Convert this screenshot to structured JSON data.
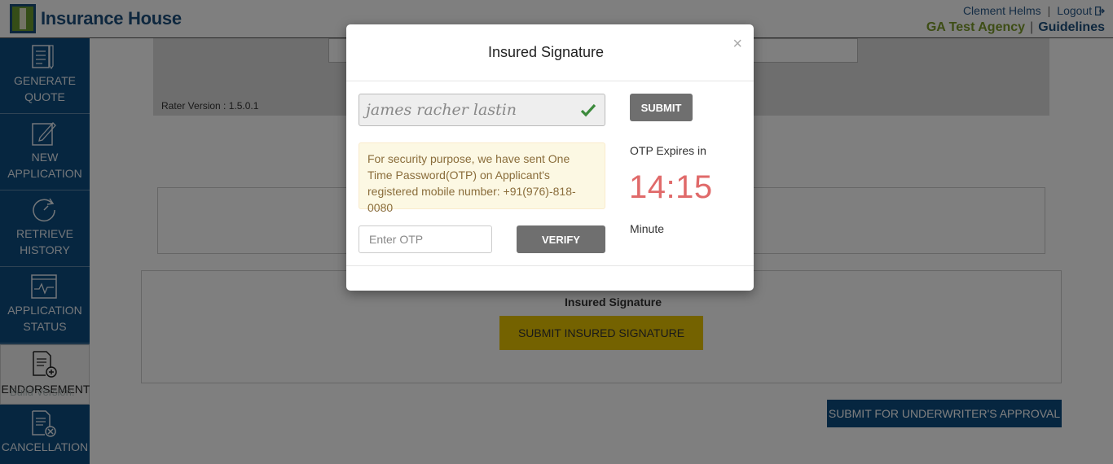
{
  "header": {
    "logo_text": "Insurance House",
    "user_name": "Clement Helms",
    "logout_label": "Logout",
    "agency_name": "GA Test Agency",
    "guidelines_label": "Guidelines"
  },
  "sidebar": {
    "items": [
      {
        "label": "GENERATE QUOTE",
        "icon": "generate-quote-icon"
      },
      {
        "label": "NEW APPLICATION",
        "icon": "edit-icon"
      },
      {
        "label": "RETRIEVE HISTORY",
        "icon": "history-icon"
      },
      {
        "label": "APPLICATION STATUS",
        "icon": "status-chart-icon"
      },
      {
        "label": "ENDORSEMENT",
        "icon": "endorsement-icon"
      },
      {
        "label": "CANCELLATION",
        "icon": "cancellation-icon"
      }
    ],
    "build_version": "Build Version:"
  },
  "main": {
    "rater_version": "Rater Version : 1.5.0.1",
    "insured_signature_label": "Insured Signature",
    "submit_insured_signature": "SUBMIT INSURED SIGNATURE",
    "submit_underwriter": "SUBMIT FOR UNDERWRITER'S APPROVAL"
  },
  "modal": {
    "title": "Insured Signature",
    "close_symbol": "×",
    "signature_value": "james racher lastin",
    "submit_label": "SUBMIT",
    "otp_message": "For security purpose, we have sent One Time Password(OTP) on Applicant's registered mobile number: +91(976)-818-0080",
    "otp_placeholder": "Enter OTP",
    "verify_label": "VERIFY",
    "expires_label": "OTP Expires in",
    "timer_value": "14:15",
    "minute_label": "Minute"
  },
  "colors": {
    "brand_blue": "#0d4c80",
    "agency_green": "#7a9a2a",
    "timer_red": "#e06a6a",
    "warning_bg": "#fcf8e3",
    "signature_button_yellow": "#e8c400"
  }
}
